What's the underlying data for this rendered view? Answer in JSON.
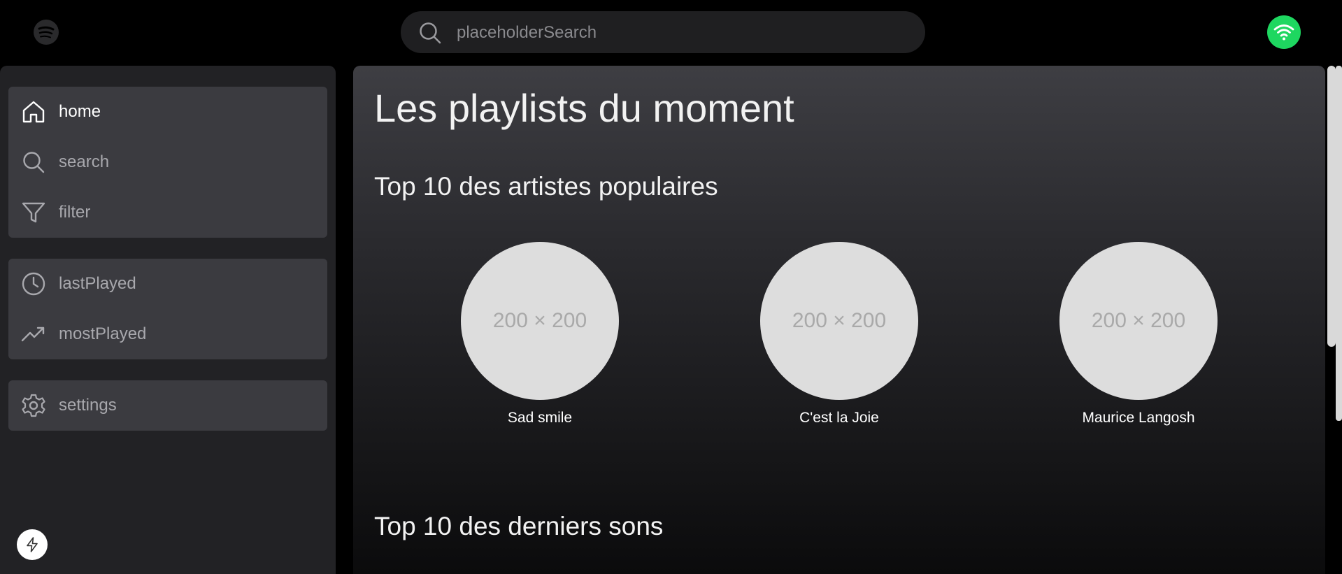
{
  "header": {
    "logo_icon": "spotify-logo-icon",
    "search": {
      "placeholder": "placeholderSearch",
      "value": "",
      "icon": "search-icon"
    },
    "status_icon": "wifi-icon",
    "status_color": "#1ed760"
  },
  "sidebar": {
    "groups": [
      {
        "items": [
          {
            "label": "home",
            "icon": "home-icon",
            "active": true
          },
          {
            "label": "search",
            "icon": "search-icon",
            "active": false
          },
          {
            "label": "filter",
            "icon": "filter-icon",
            "active": false
          }
        ]
      },
      {
        "items": [
          {
            "label": "lastPlayed",
            "icon": "clock-icon",
            "active": false
          },
          {
            "label": "mostPlayed",
            "icon": "trending-up-icon",
            "active": false
          }
        ]
      },
      {
        "items": [
          {
            "label": "settings",
            "icon": "gear-icon",
            "active": false
          }
        ]
      }
    ],
    "footer_icon": "bolt-icon"
  },
  "main": {
    "title": "Les playlists du moment",
    "sections": [
      {
        "title": "Top 10 des artistes populaires",
        "artists": [
          {
            "name": "Sad smile",
            "placeholder": "200 × 200"
          },
          {
            "name": "C'est la Joie",
            "placeholder": "200 × 200"
          },
          {
            "name": "Maurice Langosh",
            "placeholder": "200 × 200"
          }
        ]
      },
      {
        "title": "Top 10 des derniers sons"
      }
    ]
  },
  "colors": {
    "background": "#000000",
    "sidebar": "#222225",
    "nav_group": "#3b3b40",
    "accent": "#1ed760"
  }
}
